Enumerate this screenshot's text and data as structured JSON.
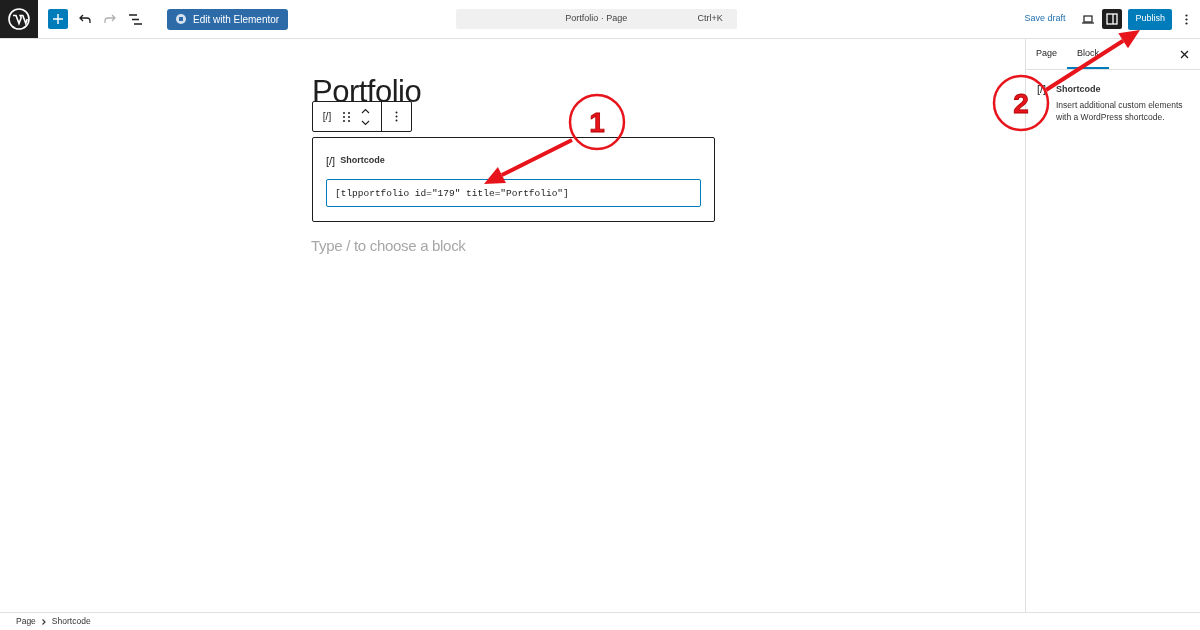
{
  "toolbar": {
    "elementor_button": "Edit with Elementor",
    "redo_disabled": true,
    "command_bar": {
      "title": "Portfolio · Page",
      "shortcut": "Ctrl+K"
    },
    "save_draft": "Save draft",
    "sidebar_toggle_on": true,
    "publish": "Publish"
  },
  "editor": {
    "title": "Portfolio",
    "block_toolbar_icon": "[/]",
    "block": {
      "icon_text": "[/]",
      "label": "Shortcode",
      "value": "[tlpportfolio id=\"179\" title=\"Portfolio\"]"
    },
    "appender": {
      "placeholder": "Type / to choose a block"
    }
  },
  "sidebar": {
    "tabs": [
      {
        "label": "Page",
        "selected": false
      },
      {
        "label": "Block",
        "selected": true
      }
    ],
    "block_card": {
      "icon_text": "[/]",
      "title": "Shortcode",
      "description": "Insert additional custom elements with a WordPress shortcode."
    }
  },
  "breadcrumbs": [
    "Page",
    "Shortcode"
  ],
  "annotations": [
    {
      "number": "1"
    },
    {
      "number": "2"
    }
  ]
}
